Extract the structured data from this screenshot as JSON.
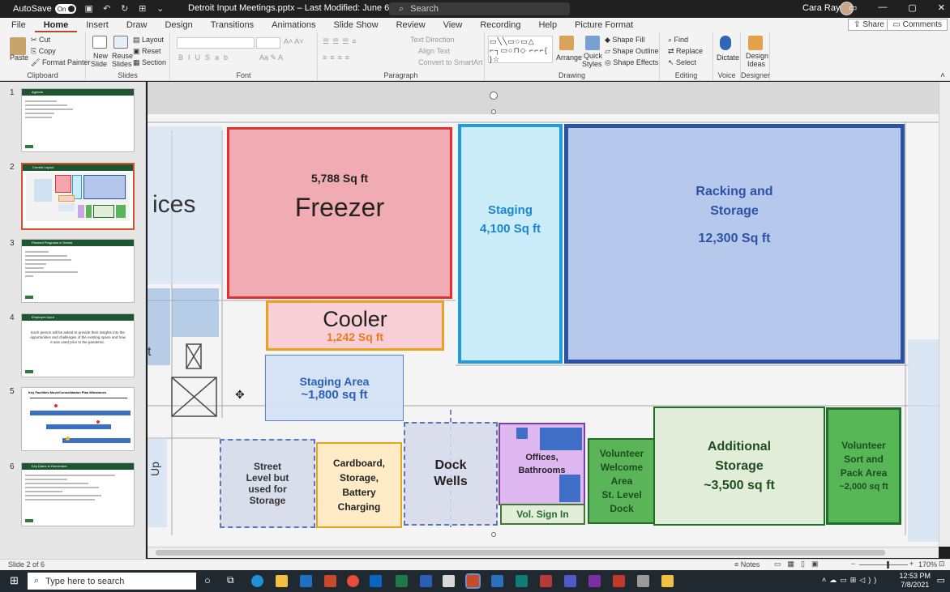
{
  "titlebar": {
    "autosave_label": "AutoSave",
    "autosave_state": "On",
    "doc_title": "Detroit Input Meetings.pptx",
    "modified": "Last Modified: June 6",
    "search_placeholder": "Search",
    "user_name": "Cara Rayner"
  },
  "ribbon_tabs": [
    "File",
    "Home",
    "Insert",
    "Draw",
    "Design",
    "Transitions",
    "Animations",
    "Slide Show",
    "Review",
    "View",
    "Recording",
    "Help",
    "Picture Format"
  ],
  "actions": {
    "share": "Share",
    "comments": "Comments"
  },
  "ribbon": {
    "paste": "Paste",
    "cut": "Cut",
    "copy": "Copy",
    "format_painter": "Format Painter",
    "clipboard": "Clipboard",
    "new_slide_1": "New",
    "new_slide_2": "Slide",
    "reuse_1": "Reuse",
    "reuse_2": "Slides",
    "layout": "Layout",
    "reset": "Reset",
    "section": "Section",
    "slides": "Slides",
    "font": "Font",
    "text_direction": "Text Direction",
    "align_text": "Align Text",
    "convert_smartart": "Convert to SmartArt",
    "paragraph": "Paragraph",
    "arrange": "Arrange",
    "quick_styles_1": "Quick",
    "quick_styles_2": "Styles",
    "shape_fill": "Shape Fill",
    "shape_outline": "Shape Outline",
    "shape_effects": "Shape Effects",
    "drawing": "Drawing",
    "find": "Find",
    "replace": "Replace",
    "select": "Select",
    "editing": "Editing",
    "dictate": "Dictate",
    "voice": "Voice",
    "design_ideas_1": "Design",
    "design_ideas_2": "Ideas",
    "designer": "Designer"
  },
  "slides_pane": [
    {
      "num": "1",
      "title": "Agenda"
    },
    {
      "num": "2",
      "title": "Current Layout"
    },
    {
      "num": "3",
      "title": "Planned Programs in Detroit"
    },
    {
      "num": "4",
      "title": "Employee Input"
    },
    {
      "num": "5",
      "title": "Key Facilities Move/Consolidation Plan Milestones"
    },
    {
      "num": "6",
      "title": "Key Dates to Remember"
    }
  ],
  "thumb4_text": "Each person will be asked to provide their insights into the opportunities and challenges of the existing space and how it was used prior to the pandemic.",
  "floor_plan": {
    "ices": "ices",
    "up": "Up",
    "t": "t",
    "freezer_area": "5,788 Sq ft",
    "freezer": "Freezer",
    "cooler": "Cooler",
    "cooler_area": "1,242 Sq ft",
    "staging_area_label": "Staging Area",
    "staging_area_size": "~1,800 sq ft",
    "staging": "Staging",
    "staging_size": "4,100 Sq ft",
    "racking_1": "Racking and",
    "racking_2": "Storage",
    "racking_size": "12,300 Sq ft",
    "street_1": "Street",
    "street_2": "Level but",
    "street_3": "used for",
    "street_4": "Storage",
    "cardboard_1": "Cardboard,",
    "cardboard_2": "Storage,",
    "cardboard_3": "Battery",
    "cardboard_4": "Charging",
    "dock_1": "Dock",
    "dock_2": "Wells",
    "offices_1": "Offices,",
    "offices_2": "Bathrooms",
    "vol_sign_in": "Vol. Sign In",
    "welcome_1": "Volunteer",
    "welcome_2": "Welcome",
    "welcome_3": "Area",
    "welcome_4": "St. Level",
    "welcome_5": "Dock",
    "additional_1": "Additional",
    "additional_2": "Storage",
    "additional_size": "~3,500 sq ft",
    "sort_1": "Volunteer",
    "sort_2": "Sort and",
    "sort_3": "Pack Area",
    "sort_size": "~2,000 sq ft"
  },
  "status": {
    "slide_of": "Slide 2 of 6",
    "notes": "Notes",
    "zoom": "170%"
  },
  "taskbar": {
    "search_placeholder": "Type here to search",
    "time": "12:53 PM",
    "date": "7/8/2021"
  }
}
